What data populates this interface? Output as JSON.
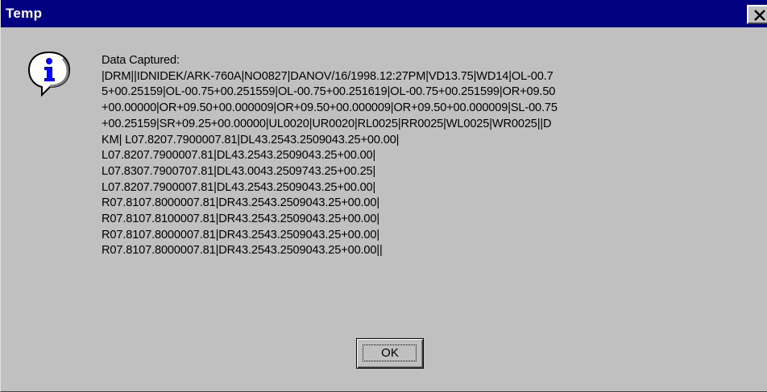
{
  "window": {
    "title": "Temp",
    "title_bar_color": "#000080",
    "face_color": "#c0c0c0",
    "close_icon": "close-icon"
  },
  "dialog": {
    "icon": "information-icon",
    "message_lines": [
      "Data Captured:",
      "|DRM||IDNIDEK/ARK-760A|NO0827|DANOV/16/1998.12:27PM|VD13.75|WD14|OL-00.7",
      "5+00.25159|OL-00.75+00.251559|OL-00.75+00.251619|OL-00.75+00.251599|OR+09.50",
      "+00.00000|OR+09.50+00.000009|OR+09.50+00.000009|OR+09.50+00.000009|SL-00.75",
      "+00.25159|SR+09.25+00.00000|UL0020|UR0020|RL0025|RR0025|WL0025|WR0025||D",
      "KM| L07.8207.7900007.81|DL43.2543.2509043.25+00.00|",
      "L07.8207.7900007.81|DL43.2543.2509043.25+00.00|",
      "L07.8307.7900707.81|DL43.0043.2509743.25+00.25|",
      "L07.8207.7900007.81|DL43.2543.2509043.25+00.00|",
      "R07.8107.8000007.81|DR43.2543.2509043.25+00.00|",
      "R07.8107.8100007.81|DR43.2543.2509043.25+00.00|",
      "R07.8107.8000007.81|DR43.2543.2509043.25+00.00|",
      "R07.8107.8000007.81|DR43.2543.2509043.25+00.00||"
    ],
    "ok_label": "OK"
  }
}
